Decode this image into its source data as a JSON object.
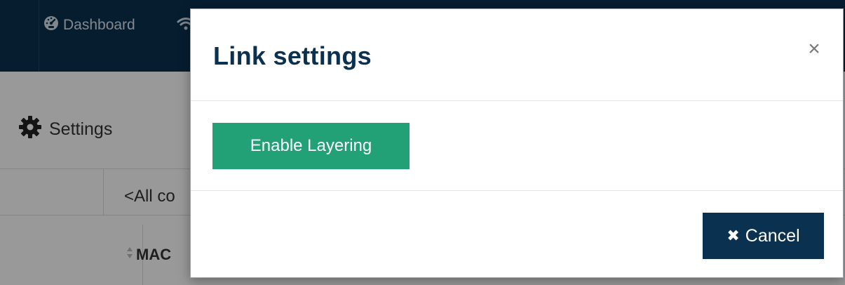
{
  "background_app": {
    "nav": {
      "dashboard_label": "Dashboard",
      "dashboard_icon": "tachometer-icon",
      "wifi_icon": "wifi-icon"
    },
    "settings_heading": "Settings",
    "settings_icon": "gear-icon",
    "filter_text": "<All co",
    "table_header": {
      "mac_label": "MAC",
      "sort_icon": "sort-icon"
    }
  },
  "modal": {
    "title": "Link settings",
    "close_glyph": "×",
    "enable_layering_label": "Enable Layering",
    "cancel_label": "Cancel",
    "cancel_glyph": "✖"
  },
  "colors": {
    "navbar": "#0b3150",
    "primary_button": "#0b3150",
    "success_button": "#22a176",
    "title_text": "#0b3150"
  }
}
